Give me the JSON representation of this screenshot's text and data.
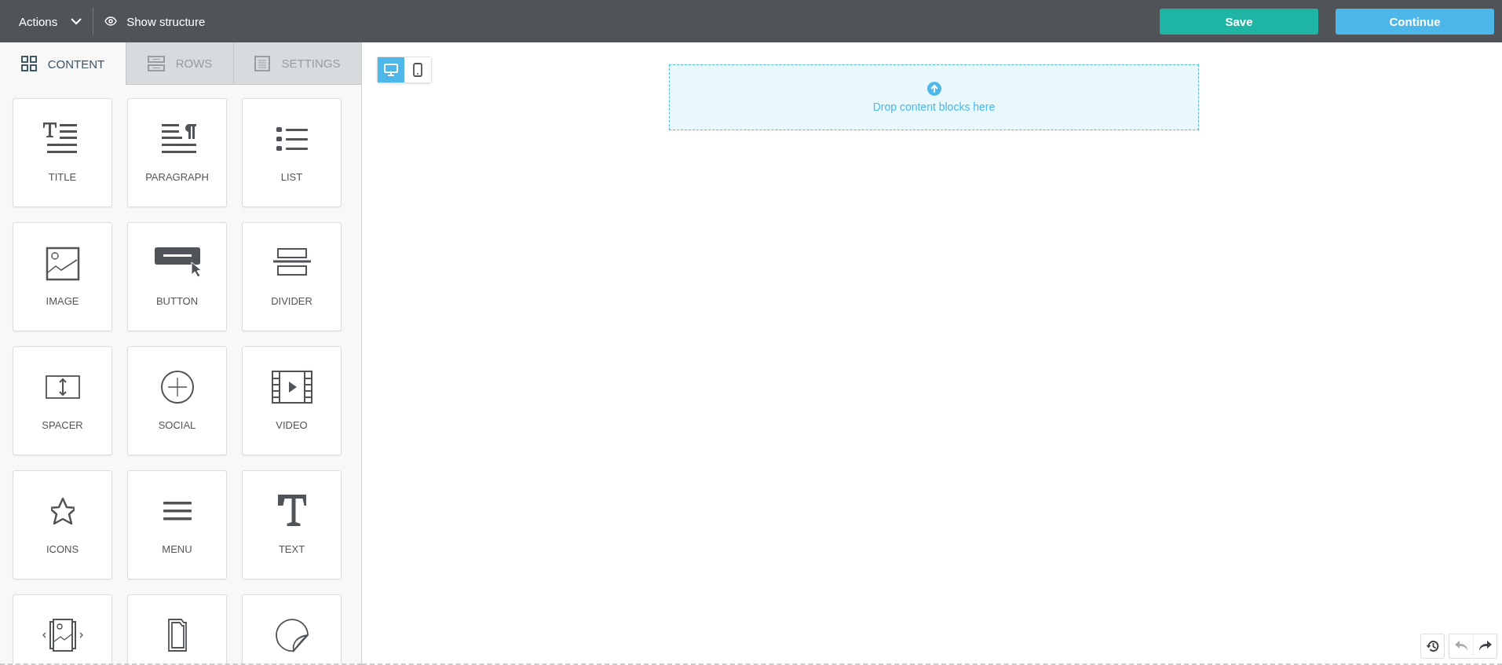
{
  "top_bar": {
    "actions": "Actions",
    "show_structure": "Show structure",
    "buttons": [
      {
        "label": "Save",
        "kind": "save"
      },
      {
        "label": "Continue",
        "kind": "continue"
      }
    ]
  },
  "sidebar": {
    "tabs": [
      {
        "label": "CONTENT",
        "kind": "content",
        "selected": true
      },
      {
        "label": "ROWS",
        "kind": "rows",
        "selected": false
      },
      {
        "label": "SETTINGS",
        "kind": "settings",
        "selected": false
      }
    ],
    "blocks": [
      {
        "label": "TITLE",
        "kind": "title"
      },
      {
        "label": "PARAGRAPH",
        "kind": "paragraph"
      },
      {
        "label": "LIST",
        "kind": "list"
      },
      {
        "label": "IMAGE",
        "kind": "image"
      },
      {
        "label": "BUTTON",
        "kind": "button"
      },
      {
        "label": "DIVIDER",
        "kind": "divider"
      },
      {
        "label": "SPACER",
        "kind": "spacer"
      },
      {
        "label": "SOCIAL",
        "kind": "social"
      },
      {
        "label": "VIDEO",
        "kind": "video"
      },
      {
        "label": "ICONS",
        "kind": "icons"
      },
      {
        "label": "MENU",
        "kind": "menu"
      },
      {
        "label": "TEXT",
        "kind": "text"
      },
      {
        "kind": "carousel"
      },
      {
        "kind": "file"
      },
      {
        "kind": "sticker"
      }
    ]
  },
  "canvas": {
    "devices": [
      {
        "kind": "desktop",
        "selected": true
      },
      {
        "kind": "mobile",
        "selected": false
      }
    ],
    "drop_zone": "Drop content blocks here",
    "history": [
      {
        "kind": "history",
        "disabled": false
      },
      {
        "kind": "undo",
        "disabled": true
      },
      {
        "kind": "redo",
        "disabled": false
      }
    ]
  }
}
